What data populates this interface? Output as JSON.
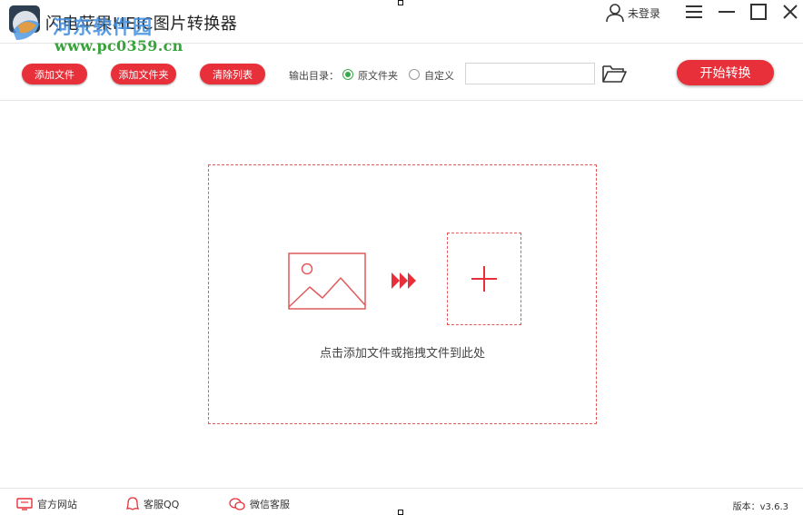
{
  "app": {
    "title": "闪电苹果HEIC图片转换器",
    "watermark_text": "河东软件园",
    "watermark_url": "www.pc0359.cn"
  },
  "window": {
    "user_label": "未登录"
  },
  "toolbar": {
    "add_file_label": "添加文件",
    "add_folder_label": "添加文件夹",
    "clear_list_label": "清除列表",
    "output_dir_label": "输出目录：",
    "option_original": "原文件夹",
    "option_custom": "自定义",
    "selected_option": "原文件夹",
    "path_value": "",
    "start_label": "开始转换"
  },
  "dropzone": {
    "hint": "点击添加文件或拖拽文件到此处"
  },
  "statusbar": {
    "website_label": "官方网站",
    "qq_label": "客服QQ",
    "wechat_label": "微信客服",
    "version": "版本：v3.6.3"
  },
  "colors": {
    "accent": "#e8303a",
    "radio_selected": "#3aa84a",
    "watermark_blue": "#3d8de0",
    "watermark_green": "#37a33a"
  },
  "icons": {
    "logo": "app-logo-icon",
    "user": "user-icon",
    "menu": "hamburger-menu-icon",
    "minimize": "minimize-icon",
    "maximize": "maximize-icon",
    "close": "close-icon",
    "folder": "folder-open-icon",
    "image": "image-placeholder-icon",
    "arrows": "forward-arrows-icon",
    "plus": "plus-icon",
    "website": "monitor-icon",
    "qq": "qq-penguin-icon",
    "wechat": "wechat-icon"
  }
}
